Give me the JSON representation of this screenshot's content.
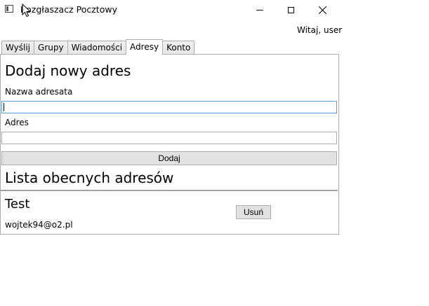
{
  "window": {
    "title": "Rozgłaszacz Pocztowy",
    "welcome": "Witaj, user"
  },
  "tabs": [
    {
      "label": "Wyślij",
      "active": false
    },
    {
      "label": "Grupy",
      "active": false
    },
    {
      "label": "Wiadomości",
      "active": false
    },
    {
      "label": "Adresy",
      "active": true
    },
    {
      "label": "Konto",
      "active": false
    }
  ],
  "add_section": {
    "heading": "Dodaj nowy adres",
    "name_label": "Nazwa adresata",
    "name_value": "",
    "address_label": "Adres",
    "address_value": "",
    "add_button": "Dodaj"
  },
  "list_section": {
    "heading": "Lista obecnych adresów",
    "entries": [
      {
        "name": "Test",
        "email": "wojtek94@o2.pl",
        "remove_label": "Usuń"
      }
    ]
  }
}
